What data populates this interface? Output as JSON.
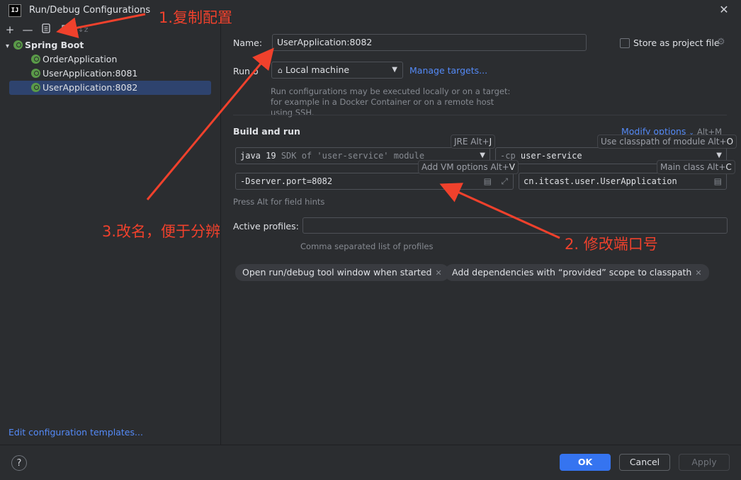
{
  "window": {
    "title": "Run/Debug Configurations",
    "logo": "IJ"
  },
  "toolbar": {
    "icons": [
      "add-icon",
      "remove-icon",
      "copy-icon",
      "save-icon",
      "sort-icon"
    ]
  },
  "tree": {
    "group_label": "Spring Boot",
    "items": [
      {
        "label": "OrderApplication"
      },
      {
        "label": "UserApplication:8081"
      },
      {
        "label": "UserApplication:8082",
        "selected": true
      }
    ]
  },
  "left_footer": {
    "edit_templates": "Edit configuration templates..."
  },
  "form": {
    "name_label": "Name:",
    "name_value": "UserApplication:8082",
    "store_label": "Store as project file",
    "run_on_label": "Run o",
    "run_on_value": "Local machine",
    "manage_targets": "Manage targets...",
    "run_on_hint": "Run configurations may be executed locally or on a target: for example in a Docker Container or on a remote host using SSH.",
    "build_run_title": "Build and run",
    "modify_options": "Modify options",
    "modify_shortcut": "Alt+M",
    "jre_value": "java 19",
    "jre_sdk": "SDK of 'user-service' module",
    "cp_prefix": "-cp",
    "cp_value": "user-service",
    "vm_options_value": "-Dserver.port=8082",
    "main_class_value": "cn.itcast.user.UserApplication",
    "field_hint": "Press Alt for field hints",
    "active_profiles_label": "Active profiles:",
    "active_profiles_value": "",
    "profiles_hint": "Comma separated list of profiles"
  },
  "tooltips": {
    "jre": {
      "text": "JRE Alt+",
      "key": "J"
    },
    "classpath": {
      "text": "Use classpath of module Alt+",
      "key": "O"
    },
    "vm": {
      "text": "Add VM options Alt+",
      "key": "V"
    },
    "main_class": {
      "text": "Main class Alt+",
      "key": "C"
    }
  },
  "chips": [
    {
      "label": "Open run/debug tool window when started"
    },
    {
      "label": "Add dependencies with  “provided”  scope to classpath"
    }
  ],
  "buttons": {
    "ok": "OK",
    "cancel": "Cancel",
    "apply": "Apply",
    "help": "?"
  },
  "annotations": {
    "a1": "1.复制配置",
    "a2": "2. 修改端口号",
    "a3": "3.改名，便于分辨"
  },
  "colors": {
    "annotation": "#f0412c",
    "accent": "#3574f0",
    "selection": "#2e436e"
  }
}
